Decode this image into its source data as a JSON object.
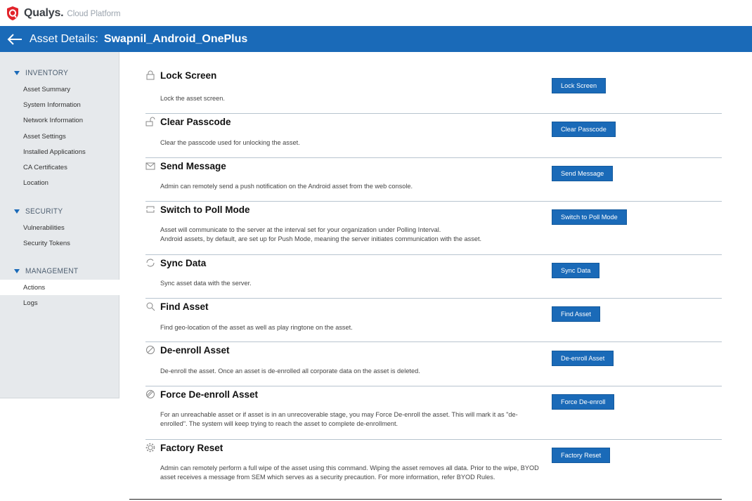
{
  "topbar": {
    "brand": "Qualys.",
    "brand_sub": "Cloud Platform",
    "logo_icon": "qualys-shield-icon"
  },
  "header": {
    "prefix": "Asset Details:",
    "asset_name": "Swapnil_Android_OnePlus",
    "background": "#1a6ab8"
  },
  "sidebar": {
    "sections": [
      {
        "title": "INVENTORY",
        "items": [
          "Asset Summary",
          "System Information",
          "Network Information",
          "Asset Settings",
          "Installed Applications",
          "CA Certificates",
          "Location"
        ]
      },
      {
        "title": "SECURITY",
        "items": [
          "Vulnerabilities",
          "Security Tokens"
        ]
      },
      {
        "title": "MANAGEMENT",
        "items": [
          "Actions",
          "Logs"
        ]
      }
    ],
    "active_item": "Actions"
  },
  "actions": [
    {
      "icon": "lock-icon",
      "title": "Lock Screen",
      "desc": "Lock the asset screen.",
      "button": "Lock Screen"
    },
    {
      "icon": "unlock-icon",
      "title": "Clear Passcode",
      "desc": "Clear the passcode used for unlocking the asset.",
      "button": "Clear Passcode"
    },
    {
      "icon": "envelope-icon",
      "title": "Send Message",
      "desc": "Admin can remotely send a push notification on the Android asset from the web console.",
      "button": "Send Message"
    },
    {
      "icon": "switch-arrows-icon",
      "title": "Switch to Poll Mode",
      "desc": "Asset will communicate to the server at the interval set for your organization under Polling Interval.\nAndroid assets, by default, are set up for Push Mode, meaning the server initiates communication with the asset.",
      "button": "Switch to Poll Mode"
    },
    {
      "icon": "sync-icon",
      "title": "Sync Data",
      "desc": "Sync asset data with the server.",
      "button": "Sync Data"
    },
    {
      "icon": "search-icon",
      "title": "Find Asset",
      "desc": "Find geo-location of the asset as well as play ringtone on the asset.",
      "button": "Find Asset"
    },
    {
      "icon": "prohibited-icon",
      "title": "De-enroll Asset",
      "desc": "De-enroll the asset. Once an asset is de-enrolled all corporate data on the asset is deleted.",
      "button": "De-enroll Asset"
    },
    {
      "icon": "force-prohibited-icon",
      "title": "Force De-enroll Asset",
      "desc": "For an unreachable asset or if asset is in an unrecoverable stage, you may Force De-enroll the asset. This will mark it as \"de-enrolled\". The system will keep trying to reach the asset to complete de-enrollment.",
      "button": "Force De-enroll"
    },
    {
      "icon": "gear-icon",
      "title": "Factory Reset",
      "desc": "Admin can remotely perform a full wipe of the asset using this command. Wiping the asset removes all data. Prior to the wipe, BYOD asset receives a message from SEM which serves as a security precaution. For more information, refer BYOD Rules.",
      "button": "Factory Reset"
    }
  ]
}
